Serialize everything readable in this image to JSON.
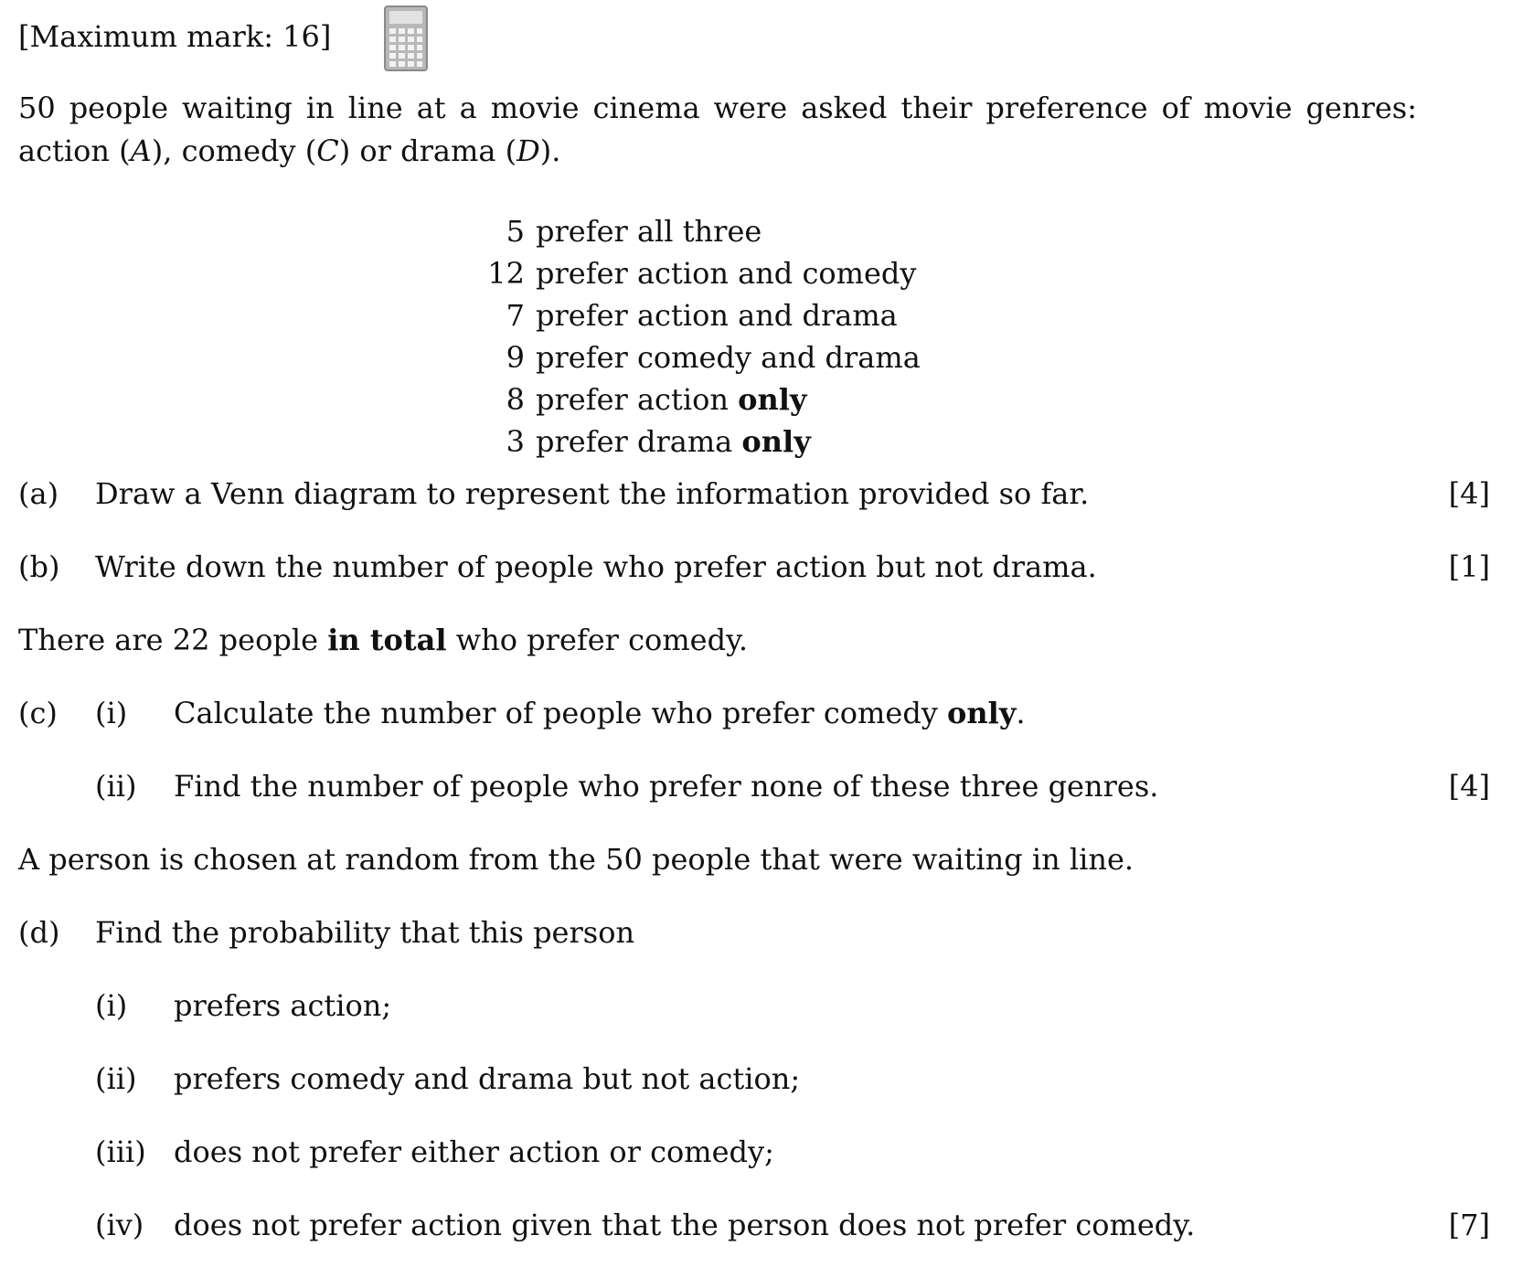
{
  "header": {
    "max_mark": "[Maximum mark: 16]",
    "calculator_icon": "calculator-icon"
  },
  "intro": {
    "line1": "50 people waiting in line at a movie cinema were asked their preference of movie genres:",
    "line2_a": "action (",
    "var_a": "A",
    "line2_b": "), comedy (",
    "var_c": "C",
    "line2_c": ") or drama (",
    "var_d": "D",
    "line2_d": ")."
  },
  "statements": [
    {
      "num": "5",
      "text": "prefer all three",
      "bold": ""
    },
    {
      "num": "12",
      "text": "prefer action and comedy",
      "bold": ""
    },
    {
      "num": "7",
      "text": "prefer action and drama",
      "bold": ""
    },
    {
      "num": "9",
      "text": "prefer comedy and drama",
      "bold": ""
    },
    {
      "num": "8",
      "text": "prefer action ",
      "bold": "only"
    },
    {
      "num": "3",
      "text": "prefer drama ",
      "bold": "only"
    }
  ],
  "part_a": {
    "label": "(a)",
    "text": "Draw a Venn diagram to represent the information provided so far.",
    "marks": "[4]"
  },
  "part_b": {
    "label": "(b)",
    "text": "Write down the number of people who prefer action but not drama.",
    "marks": "[1]"
  },
  "info_comedy": {
    "pre": "There are 22 people ",
    "bold": "in total",
    "post": " who prefer comedy."
  },
  "part_c": {
    "label": "(c)",
    "i": {
      "label": "(i)",
      "text": "Calculate the number of people who prefer comedy ",
      "bold": "only",
      "post": "."
    },
    "ii": {
      "label": "(ii)",
      "text": "Find the number of people who prefer none of these three genres."
    },
    "marks": "[4]"
  },
  "info_random": "A person is chosen at random from the 50 people that were waiting in line.",
  "part_d": {
    "label": "(d)",
    "text": "Find the probability that this person",
    "i": {
      "label": "(i)",
      "text": "prefers action;"
    },
    "ii": {
      "label": "(ii)",
      "text": "prefers comedy and drama but not action;"
    },
    "iii": {
      "label": "(iii)",
      "text": "does not prefer either action or comedy;"
    },
    "iv": {
      "label": "(iv)",
      "text": "does not prefer action given that the person does not prefer comedy."
    },
    "marks": "[7]"
  }
}
